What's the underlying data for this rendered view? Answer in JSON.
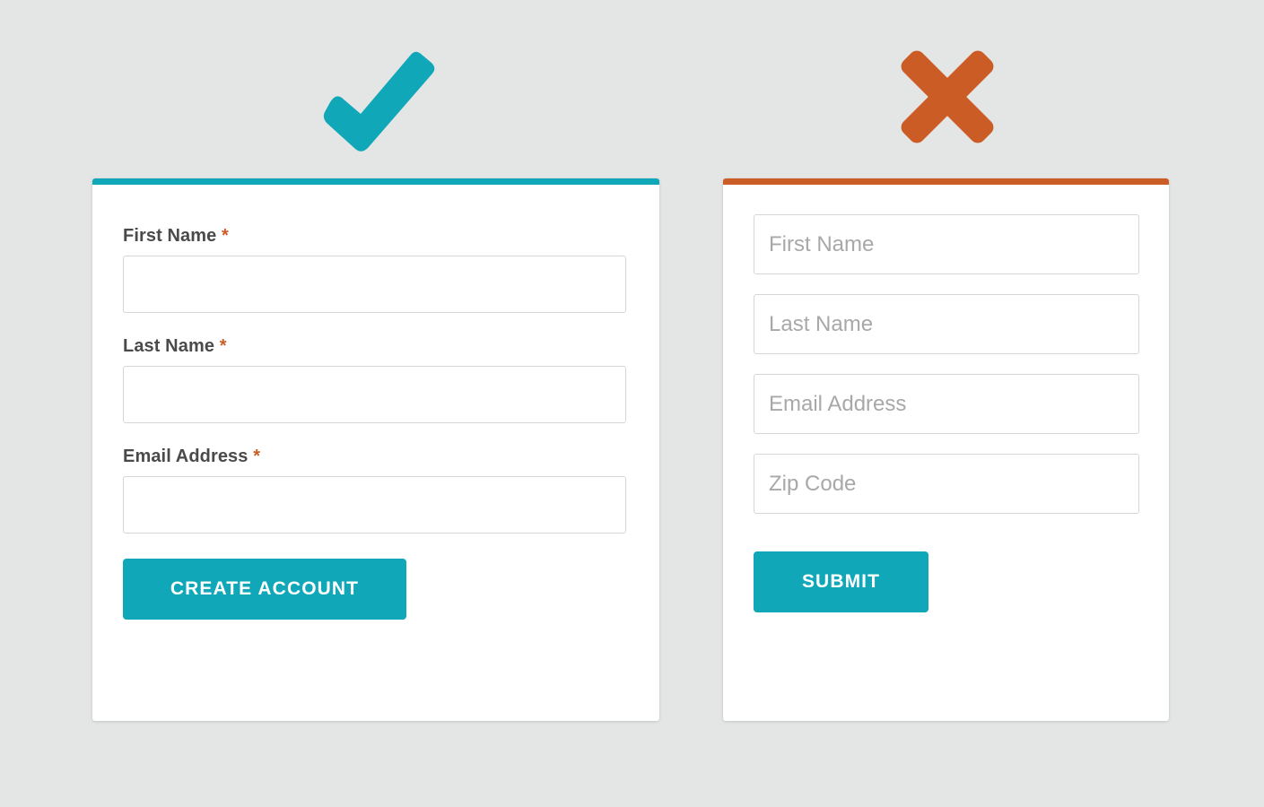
{
  "theme": {
    "background": "#e4e6e5",
    "card_background": "#ffffff",
    "accent_teal": "#10a8b8",
    "accent_orange": "#cc5c26",
    "label_color": "#4a4a4a",
    "placeholder_color": "#a8a8a8",
    "input_border": "#d6d6d6"
  },
  "good_example": {
    "status_icon": "checkmark-icon",
    "accent_color": "#10a8b8",
    "fields": [
      {
        "label": "First Name",
        "required_marker": "*",
        "value": "",
        "placeholder": ""
      },
      {
        "label": "Last Name",
        "required_marker": "*",
        "value": "",
        "placeholder": ""
      },
      {
        "label": "Email Address",
        "required_marker": "*",
        "value": "",
        "placeholder": ""
      }
    ],
    "submit_button": {
      "label": "CREATE ACCOUNT",
      "background": "#10a8b8",
      "text_color": "#ffffff"
    }
  },
  "bad_example": {
    "status_icon": "cross-icon",
    "accent_color": "#cc5c26",
    "fields": [
      {
        "label": "",
        "required_marker": "",
        "value": "",
        "placeholder": "First Name"
      },
      {
        "label": "",
        "required_marker": "",
        "value": "",
        "placeholder": "Last Name"
      },
      {
        "label": "",
        "required_marker": "",
        "value": "",
        "placeholder": "Email Address"
      },
      {
        "label": "",
        "required_marker": "",
        "value": "",
        "placeholder": "Zip Code"
      }
    ],
    "submit_button": {
      "label": "SUBMIT",
      "background": "#10a8b8",
      "text_color": "#ffffff"
    }
  }
}
